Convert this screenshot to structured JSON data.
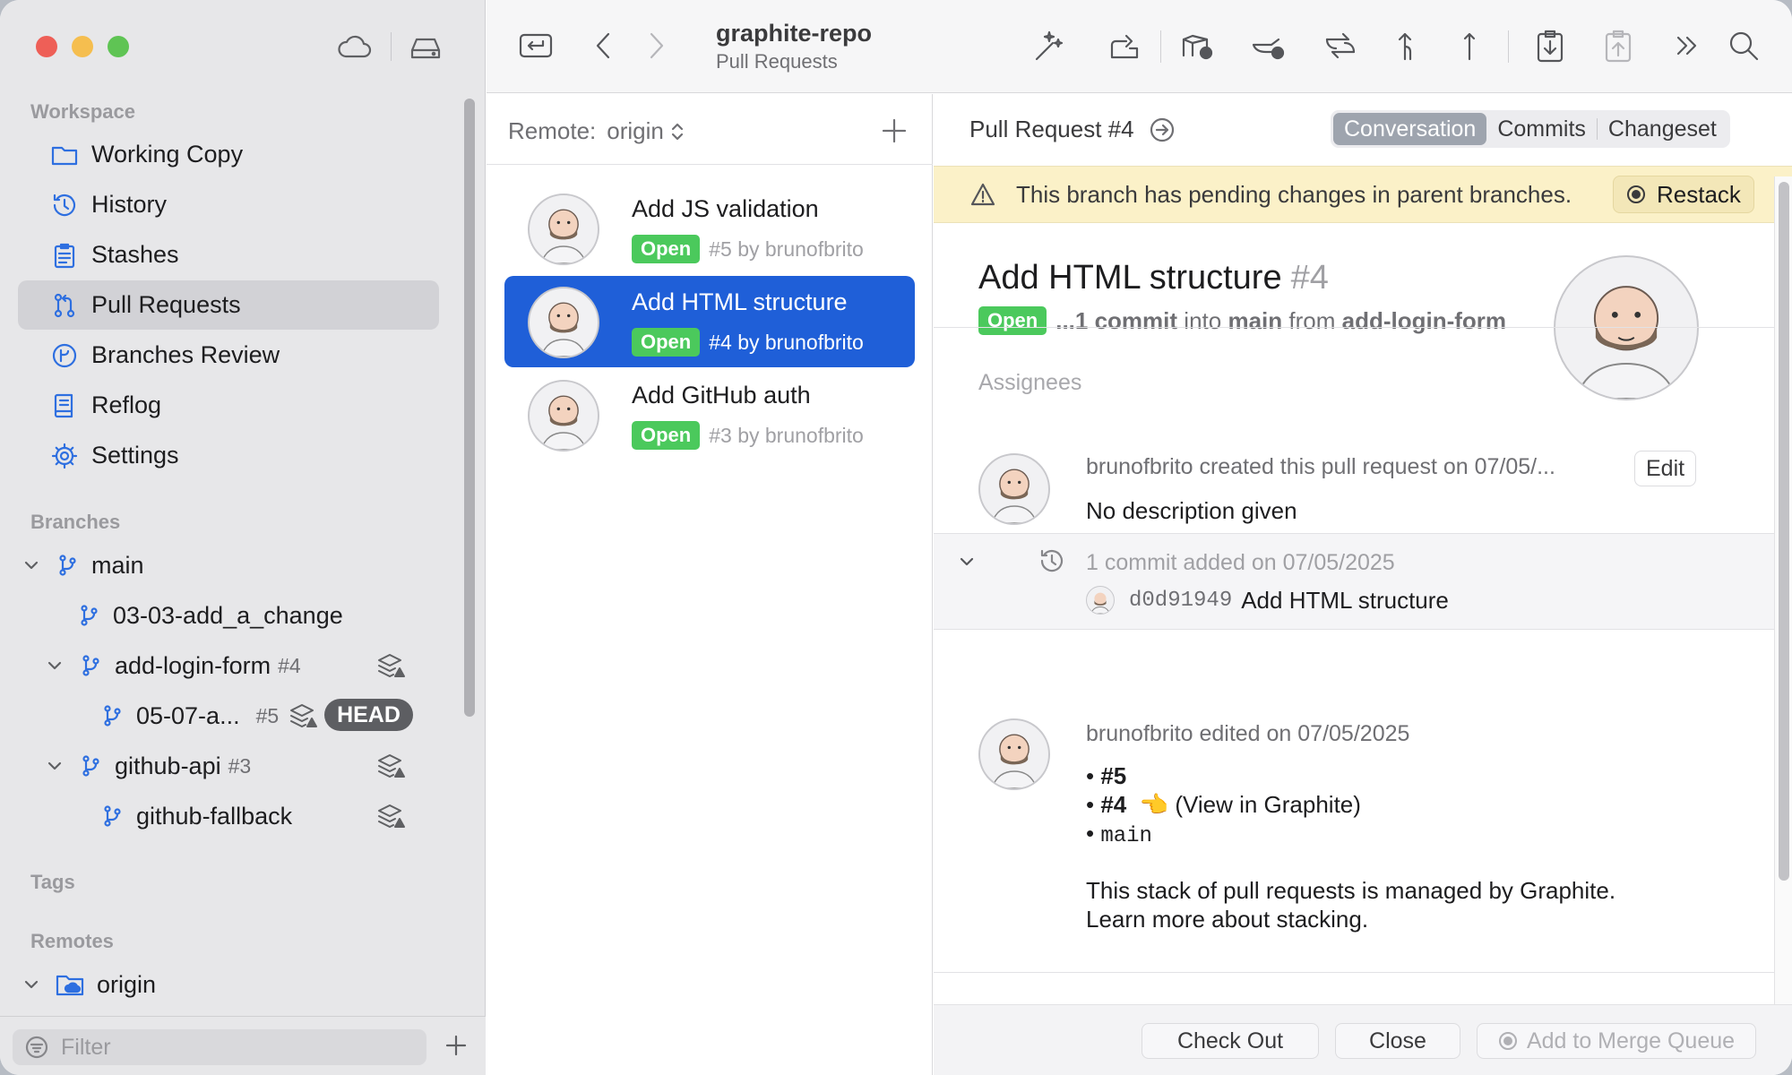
{
  "sidebar": {
    "workspace_title": "Workspace",
    "items": [
      {
        "label": "Working Copy",
        "icon": "folder-icon"
      },
      {
        "label": "History",
        "icon": "history-icon"
      },
      {
        "label": "Stashes",
        "icon": "clipboard-icon"
      },
      {
        "label": "Pull Requests",
        "icon": "pull-request-icon",
        "selected": true
      },
      {
        "label": "Branches Review",
        "icon": "branches-review-icon"
      },
      {
        "label": "Reflog",
        "icon": "book-icon"
      },
      {
        "label": "Settings",
        "icon": "gear-icon"
      }
    ],
    "branches_title": "Branches",
    "branches": [
      {
        "name": "main"
      },
      {
        "name": "03-03-add_a_change"
      },
      {
        "name": "add-login-form",
        "num": "#4"
      },
      {
        "name": "05-07-a...",
        "num": "#5",
        "badge": "HEAD"
      },
      {
        "name": "github-api",
        "num": "#3"
      },
      {
        "name": "github-fallback"
      }
    ],
    "tags_title": "Tags",
    "remotes_title": "Remotes",
    "remotes": [
      {
        "name": "origin"
      }
    ],
    "filter_placeholder": "Filter"
  },
  "toolbar": {
    "title": "graphite-repo",
    "subtitle": "Pull Requests"
  },
  "list": {
    "remote_label": "Remote:",
    "remote_value": "origin",
    "items": [
      {
        "title": "Add JS validation",
        "status": "Open",
        "meta": "#5 by brunofbrito"
      },
      {
        "title": "Add HTML structure",
        "status": "Open",
        "meta": "#4 by brunofbrito",
        "selected": true
      },
      {
        "title": "Add GitHub auth",
        "status": "Open",
        "meta": "#3 by brunofbrito"
      }
    ]
  },
  "detail": {
    "header": "Pull Request #4",
    "tabs": [
      "Conversation",
      "Commits",
      "Changeset"
    ],
    "active_tab": "Conversation",
    "warning": "This branch has pending changes in parent branches.",
    "restack_label": "Restack",
    "title": "Add HTML structure",
    "number": "#4",
    "status": "Open",
    "sub_commits": "...1 commit",
    "sub_into": "into",
    "sub_base": "main",
    "sub_from": "from",
    "sub_head": "add-login-form",
    "assignees": "Assignees",
    "comment1_header": "brunofbrito created this pull request on 07/05/...",
    "edit_label": "Edit",
    "comment1_body": "No description given",
    "commits_line": "1 commit added on 07/05/2025",
    "commit_sha": "d0d91949",
    "commit_msg": "Add HTML structure",
    "comment3_header": "brunofbrito edited on 07/05/2025",
    "bullet1": "#5",
    "bullet2": "#4",
    "bullet2_emoji": "👈",
    "bullet2_link": "(View in Graphite)",
    "bullet3": "main",
    "para1": "This stack of pull requests is managed by Graphite.",
    "para2": "Learn more about stacking.",
    "footer": {
      "checkout": "Check Out",
      "close": "Close",
      "merge_queue": "Add to Merge Queue"
    }
  },
  "colors": {
    "accent": "#1f5fd8",
    "open_badge": "#4bc95c",
    "warning_bg": "#fbf1c8",
    "head_badge": "#5d5e62"
  }
}
